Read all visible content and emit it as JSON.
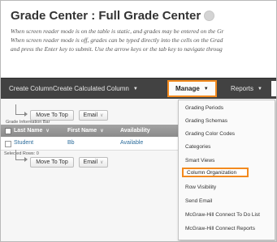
{
  "page": {
    "title": "Grade Center : Full Grade Center",
    "instructions": [
      "When screen reader mode is on the table is static, and grades may be entered on the Gr",
      "When screen reader mode is off, grades can be typed directly into the cells on the Grad",
      "and press the Enter key to submit. Use the arrow keys or the tab key to navigate throug"
    ]
  },
  "action_bar": {
    "create_column": "Create Column",
    "create_calculated_column": "Create Calculated Column",
    "manage": "Manage",
    "reports": "Reports"
  },
  "toolbar_top": {
    "move_to_top": "Move To Top",
    "email": "Email"
  },
  "grid": {
    "info_bar_label": "Grade Information Bar",
    "columns": [
      "Last Name",
      "First Name",
      "Availability"
    ],
    "rows": [
      {
        "last_name": "Student",
        "first_name": "Bb",
        "availability": "Available"
      }
    ],
    "selected_rows_label": "Selected Rows: 0"
  },
  "toolbar_bottom": {
    "move_to_top": "Move To Top",
    "email": "Email"
  },
  "manage_menu": {
    "items": [
      "Grading Periods",
      "Grading Schemas",
      "Grading Color Codes",
      "Categories",
      "Smart Views",
      "Column Organization",
      "Row Visibility",
      "Send Email",
      "McGraw-Hill Connect To Do List",
      "McGraw-Hill Connect Reports"
    ],
    "highlighted_item": "Column Organization"
  },
  "colors": {
    "highlight": "#f38a1e",
    "action_bar": "#424242",
    "link": "#2d6d9c"
  }
}
